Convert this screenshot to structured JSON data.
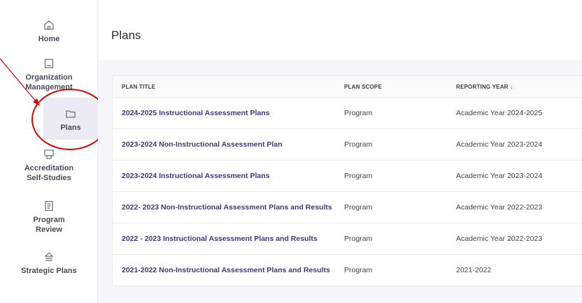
{
  "sidebar": {
    "items": [
      {
        "label": "Home",
        "icon": "home-icon"
      },
      {
        "label": "Organization Management",
        "icon": "building-icon"
      },
      {
        "label": "Plans",
        "icon": "folder-icon",
        "active": true
      },
      {
        "label": "Accreditation Self-Studies",
        "icon": "monitor-icon"
      },
      {
        "label": "Program Review",
        "icon": "document-icon"
      },
      {
        "label": "Strategic Plans",
        "icon": "stack-icon"
      }
    ]
  },
  "page": {
    "title": "Plans"
  },
  "table": {
    "columns": [
      "PLAN TITLE",
      "PLAN SCOPE",
      "REPORTING YEAR ↓"
    ],
    "rows": [
      {
        "title": "2024-2025 Instructional Assessment Plans",
        "scope": "Program",
        "year": "Academic Year 2024-2025"
      },
      {
        "title": "2023-2024 Non-Instructional Assessment Plan",
        "scope": "Program",
        "year": "Academic Year 2023-2024"
      },
      {
        "title": "2023-2024 Instructional Assessment Plans",
        "scope": "Program",
        "year": "Academic Year 2023-2024"
      },
      {
        "title": "2022- 2023 Non-Instructional Assessment Plans and Results",
        "scope": "Program",
        "year": "Academic Year 2022-2023"
      },
      {
        "title": "2022 - 2023 Instructional Assessment Plans and Results",
        "scope": "Program",
        "year": "Academic Year 2022-2023"
      },
      {
        "title": "2021-2022 Non-Instructional Assessment Plans and Results",
        "scope": "Program",
        "year": "2021-2022"
      }
    ]
  },
  "colors": {
    "accent": "#3d3a7a",
    "annotation": "#e00000",
    "active_bg": "#ecebf3"
  }
}
